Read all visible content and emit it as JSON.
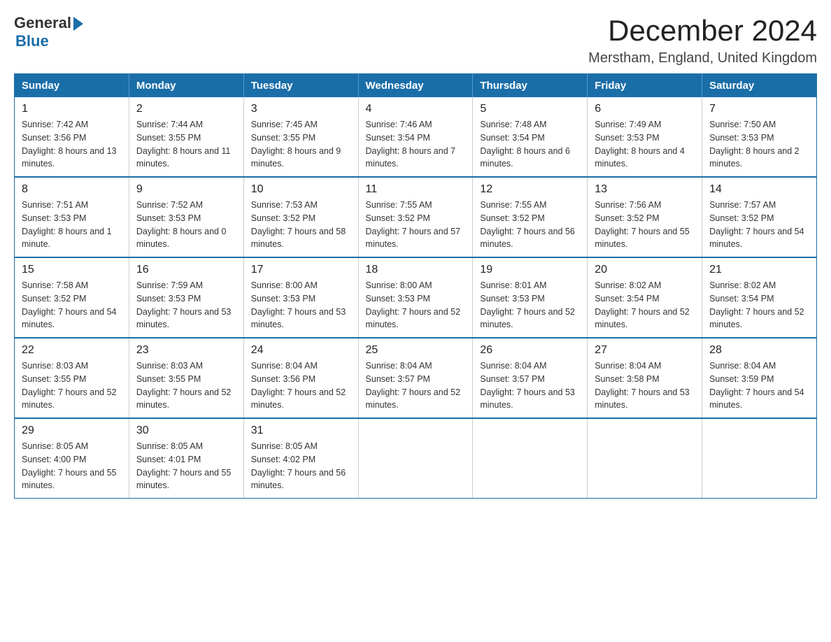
{
  "logo": {
    "general": "General",
    "blue": "Blue"
  },
  "header": {
    "title": "December 2024",
    "subtitle": "Merstham, England, United Kingdom"
  },
  "weekdays": [
    "Sunday",
    "Monday",
    "Tuesday",
    "Wednesday",
    "Thursday",
    "Friday",
    "Saturday"
  ],
  "weeks": [
    [
      {
        "day": "1",
        "sunrise": "7:42 AM",
        "sunset": "3:56 PM",
        "daylight": "8 hours and 13 minutes."
      },
      {
        "day": "2",
        "sunrise": "7:44 AM",
        "sunset": "3:55 PM",
        "daylight": "8 hours and 11 minutes."
      },
      {
        "day": "3",
        "sunrise": "7:45 AM",
        "sunset": "3:55 PM",
        "daylight": "8 hours and 9 minutes."
      },
      {
        "day": "4",
        "sunrise": "7:46 AM",
        "sunset": "3:54 PM",
        "daylight": "8 hours and 7 minutes."
      },
      {
        "day": "5",
        "sunrise": "7:48 AM",
        "sunset": "3:54 PM",
        "daylight": "8 hours and 6 minutes."
      },
      {
        "day": "6",
        "sunrise": "7:49 AM",
        "sunset": "3:53 PM",
        "daylight": "8 hours and 4 minutes."
      },
      {
        "day": "7",
        "sunrise": "7:50 AM",
        "sunset": "3:53 PM",
        "daylight": "8 hours and 2 minutes."
      }
    ],
    [
      {
        "day": "8",
        "sunrise": "7:51 AM",
        "sunset": "3:53 PM",
        "daylight": "8 hours and 1 minute."
      },
      {
        "day": "9",
        "sunrise": "7:52 AM",
        "sunset": "3:53 PM",
        "daylight": "8 hours and 0 minutes."
      },
      {
        "day": "10",
        "sunrise": "7:53 AM",
        "sunset": "3:52 PM",
        "daylight": "7 hours and 58 minutes."
      },
      {
        "day": "11",
        "sunrise": "7:55 AM",
        "sunset": "3:52 PM",
        "daylight": "7 hours and 57 minutes."
      },
      {
        "day": "12",
        "sunrise": "7:55 AM",
        "sunset": "3:52 PM",
        "daylight": "7 hours and 56 minutes."
      },
      {
        "day": "13",
        "sunrise": "7:56 AM",
        "sunset": "3:52 PM",
        "daylight": "7 hours and 55 minutes."
      },
      {
        "day": "14",
        "sunrise": "7:57 AM",
        "sunset": "3:52 PM",
        "daylight": "7 hours and 54 minutes."
      }
    ],
    [
      {
        "day": "15",
        "sunrise": "7:58 AM",
        "sunset": "3:52 PM",
        "daylight": "7 hours and 54 minutes."
      },
      {
        "day": "16",
        "sunrise": "7:59 AM",
        "sunset": "3:53 PM",
        "daylight": "7 hours and 53 minutes."
      },
      {
        "day": "17",
        "sunrise": "8:00 AM",
        "sunset": "3:53 PM",
        "daylight": "7 hours and 53 minutes."
      },
      {
        "day": "18",
        "sunrise": "8:00 AM",
        "sunset": "3:53 PM",
        "daylight": "7 hours and 52 minutes."
      },
      {
        "day": "19",
        "sunrise": "8:01 AM",
        "sunset": "3:53 PM",
        "daylight": "7 hours and 52 minutes."
      },
      {
        "day": "20",
        "sunrise": "8:02 AM",
        "sunset": "3:54 PM",
        "daylight": "7 hours and 52 minutes."
      },
      {
        "day": "21",
        "sunrise": "8:02 AM",
        "sunset": "3:54 PM",
        "daylight": "7 hours and 52 minutes."
      }
    ],
    [
      {
        "day": "22",
        "sunrise": "8:03 AM",
        "sunset": "3:55 PM",
        "daylight": "7 hours and 52 minutes."
      },
      {
        "day": "23",
        "sunrise": "8:03 AM",
        "sunset": "3:55 PM",
        "daylight": "7 hours and 52 minutes."
      },
      {
        "day": "24",
        "sunrise": "8:04 AM",
        "sunset": "3:56 PM",
        "daylight": "7 hours and 52 minutes."
      },
      {
        "day": "25",
        "sunrise": "8:04 AM",
        "sunset": "3:57 PM",
        "daylight": "7 hours and 52 minutes."
      },
      {
        "day": "26",
        "sunrise": "8:04 AM",
        "sunset": "3:57 PM",
        "daylight": "7 hours and 53 minutes."
      },
      {
        "day": "27",
        "sunrise": "8:04 AM",
        "sunset": "3:58 PM",
        "daylight": "7 hours and 53 minutes."
      },
      {
        "day": "28",
        "sunrise": "8:04 AM",
        "sunset": "3:59 PM",
        "daylight": "7 hours and 54 minutes."
      }
    ],
    [
      {
        "day": "29",
        "sunrise": "8:05 AM",
        "sunset": "4:00 PM",
        "daylight": "7 hours and 55 minutes."
      },
      {
        "day": "30",
        "sunrise": "8:05 AM",
        "sunset": "4:01 PM",
        "daylight": "7 hours and 55 minutes."
      },
      {
        "day": "31",
        "sunrise": "8:05 AM",
        "sunset": "4:02 PM",
        "daylight": "7 hours and 56 minutes."
      },
      null,
      null,
      null,
      null
    ]
  ]
}
